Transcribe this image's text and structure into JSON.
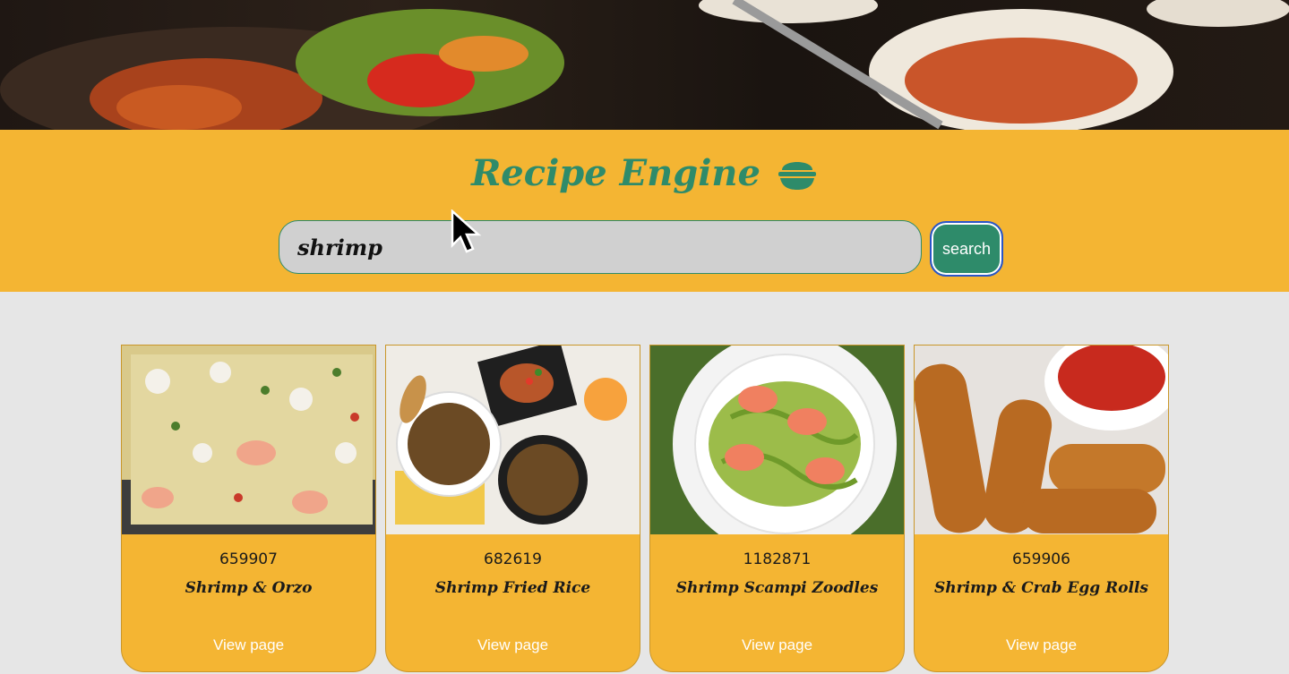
{
  "app": {
    "title": "Recipe Engine",
    "title_icon": "rice-bowl-icon",
    "accent_color": "#2e8b6a",
    "band_color": "#f4b533",
    "background_color": "#e6e6e6"
  },
  "search": {
    "value": "shrimp",
    "button_label": "search"
  },
  "results": [
    {
      "id": "659907",
      "title": "Shrimp & Orzo",
      "link_label": "View page"
    },
    {
      "id": "682619",
      "title": "Shrimp Fried Rice",
      "link_label": "View page"
    },
    {
      "id": "1182871",
      "title": "Shrimp Scampi Zoodles",
      "link_label": "View page"
    },
    {
      "id": "659906",
      "title": "Shrimp & Crab Egg Rolls",
      "link_label": "View page"
    }
  ]
}
